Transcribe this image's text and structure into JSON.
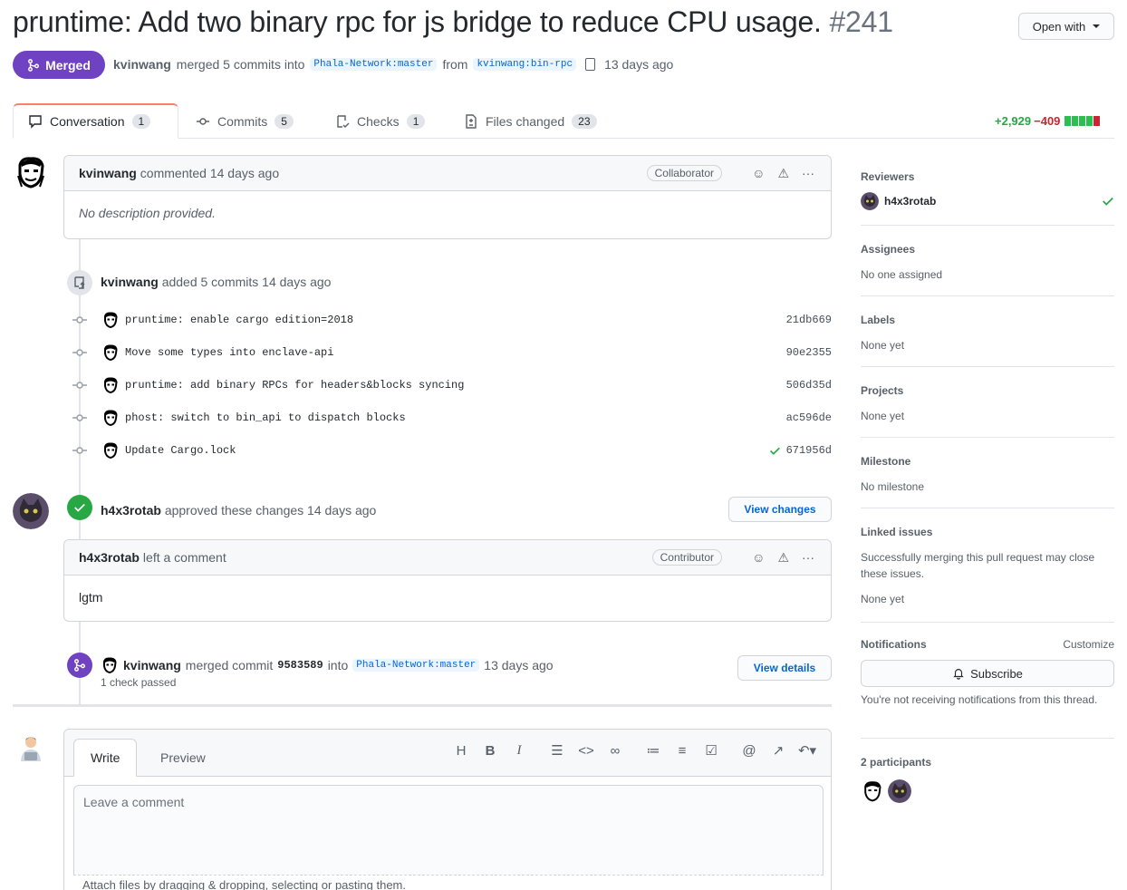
{
  "header": {
    "title": "pruntime: Add two binary rpc for js bridge to reduce CPU usage.",
    "number": "#241",
    "open_with": "Open with",
    "state": "Merged",
    "author": "kvinwang",
    "merged_text": "merged 5 commits into",
    "base_branch": "Phala-Network:master",
    "from_text": "from",
    "head_branch": "kvinwang:bin-rpc",
    "time": "13 days ago"
  },
  "tabs": [
    {
      "label": "Conversation",
      "count": "1"
    },
    {
      "label": "Commits",
      "count": "5"
    },
    {
      "label": "Checks",
      "count": "1"
    },
    {
      "label": "Files changed",
      "count": "23"
    }
  ],
  "diffstat": {
    "additions": "+2,929",
    "deletions": "−409",
    "colors": [
      "#2cbe4e",
      "#2cbe4e",
      "#2cbe4e",
      "#2cbe4e",
      "#cb2431"
    ]
  },
  "comment1": {
    "author": "kvinwang",
    "action": "commented 14 days ago",
    "role": "Collaborator",
    "body": "No description provided."
  },
  "commits_event": {
    "author": "kvinwang",
    "action": "added 5 commits 14 days ago",
    "commits": [
      {
        "message": "pruntime: enable cargo edition=2018",
        "sha": "21db669"
      },
      {
        "message": "Move some types into enclave-api",
        "sha": "90e2355"
      },
      {
        "message": "pruntime: add binary RPCs for headers&blocks syncing",
        "sha": "506d35d"
      },
      {
        "message": "phost: switch to bin_api to dispatch blocks",
        "sha": "ac596de"
      },
      {
        "message": "Update Cargo.lock",
        "sha": "671956d"
      }
    ]
  },
  "review": {
    "author": "h4x3rotab",
    "action": "approved these changes 14 days ago",
    "button": "View changes",
    "comment_author": "h4x3rotab",
    "comment_action": "left a comment",
    "role": "Contributor",
    "body": "lgtm"
  },
  "merge_event": {
    "author": "kvinwang",
    "text1": "merged commit",
    "sha": "9583589",
    "text2": "into",
    "branch": "Phala-Network:master",
    "time": "13 days ago",
    "checks": "1 check passed",
    "button": "View details"
  },
  "editor": {
    "write": "Write",
    "preview": "Preview",
    "placeholder": "Leave a comment",
    "attach": "Attach files by dragging & dropping, selecting or pasting them."
  },
  "sidebar": {
    "reviewers_title": "Reviewers",
    "reviewer": "h4x3rotab",
    "assignees_title": "Assignees",
    "assignees_val": "No one assigned",
    "labels_title": "Labels",
    "labels_val": "None yet",
    "projects_title": "Projects",
    "projects_val": "None yet",
    "milestone_title": "Milestone",
    "milestone_val": "No milestone",
    "linked_title": "Linked issues",
    "linked_desc": "Successfully merging this pull request may close these issues.",
    "linked_val": "None yet",
    "notif_title": "Notifications",
    "customize": "Customize",
    "subscribe": "Subscribe",
    "notif_desc": "You're not receiving notifications from this thread.",
    "participants": "2 participants"
  }
}
